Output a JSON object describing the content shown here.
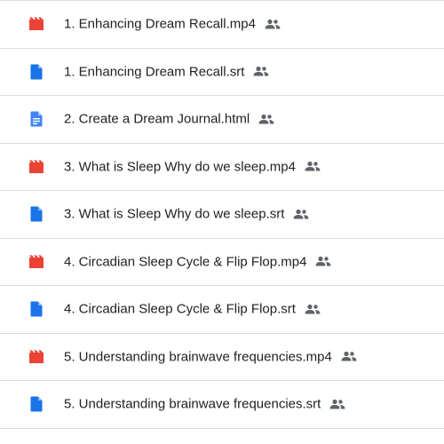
{
  "files": [
    {
      "name": "1. Enhancing Dream Recall.mp4",
      "type": "video",
      "icon": "video-file-icon",
      "shared": true
    },
    {
      "name": "1. Enhancing Dream Recall.srt",
      "type": "file",
      "icon": "generic-file-icon",
      "shared": true
    },
    {
      "name": "2. Create a Dream Journal.html",
      "type": "document",
      "icon": "document-file-icon",
      "shared": true
    },
    {
      "name": "3. What is Sleep Why do we sleep.mp4",
      "type": "video",
      "icon": "video-file-icon",
      "shared": true
    },
    {
      "name": "3. What is Sleep Why do we sleep.srt",
      "type": "file",
      "icon": "generic-file-icon",
      "shared": true
    },
    {
      "name": "4. Circadian Sleep Cycle & Flip Flop.mp4",
      "type": "video",
      "icon": "video-file-icon",
      "shared": true
    },
    {
      "name": "4. Circadian Sleep Cycle & Flip Flop.srt",
      "type": "file",
      "icon": "generic-file-icon",
      "shared": true
    },
    {
      "name": "5. Understanding brainwave frequencies.mp4",
      "type": "video",
      "icon": "video-file-icon",
      "shared": true
    },
    {
      "name": "5. Understanding brainwave frequencies.srt",
      "type": "file",
      "icon": "generic-file-icon",
      "shared": true
    }
  ],
  "colors": {
    "video": "#ea4335",
    "file": "#1a73e8",
    "document": "#4285f4",
    "shared_icon": "#5f6368",
    "text": "#202124",
    "divider": "#dadce0"
  }
}
